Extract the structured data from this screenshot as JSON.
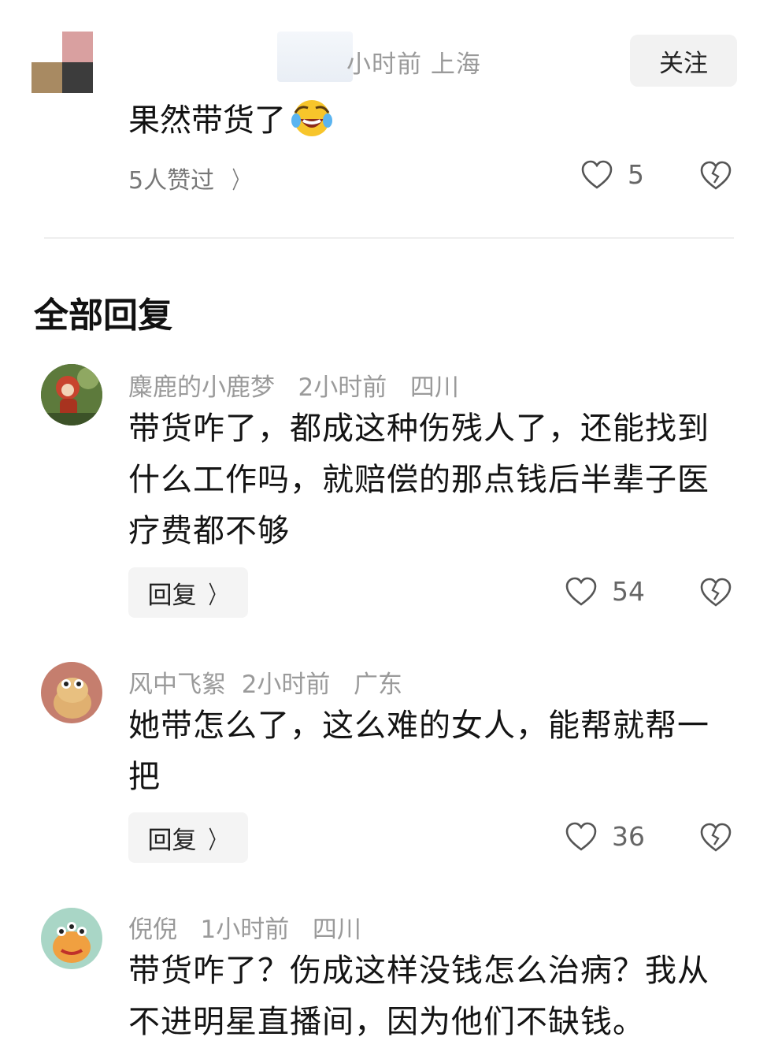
{
  "top_comment": {
    "meta": "小时前   上海",
    "follow_label": "关注",
    "text": "果然带货了",
    "liked_summary": "5人赞过",
    "like_count": "5"
  },
  "section_title": "全部回复",
  "replies": [
    {
      "meta": "麋鹿的小鹿梦   2小时前   四川",
      "text": "带货咋了，都成这种伤残人了，还能找到什么工作吗，就赔偿的那点钱后半辈子医疗费都不够",
      "reply_label": "回复",
      "like_count": "54"
    },
    {
      "meta": "风中飞絮  2小时前   广东",
      "text": "她带怎么了，这么难的女人，能帮就帮一把",
      "reply_label": "回复",
      "like_count": "36"
    },
    {
      "meta": "倪倪   1小时前   四川",
      "text": "带货咋了？伤成这样没钱怎么治病？我从不进明星直播间，因为他们不缺钱。"
    }
  ],
  "icons": {
    "like": "heart-outline-icon",
    "dislike": "broken-heart-icon",
    "chevron": "chevron-right-icon"
  }
}
